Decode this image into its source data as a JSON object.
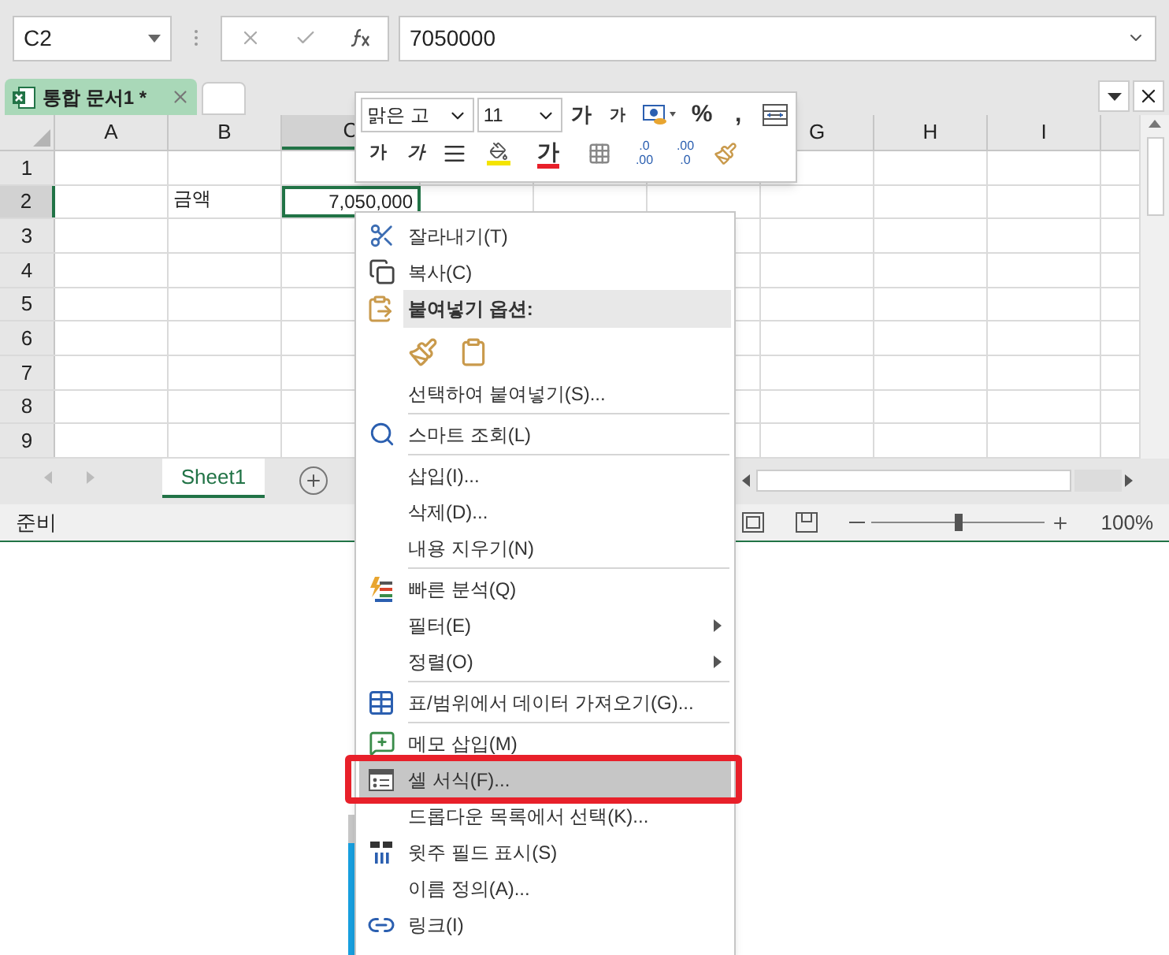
{
  "formula_bar": {
    "name_box": "C2",
    "value": "7050000"
  },
  "workbook_tab": {
    "title": "통합 문서1 *"
  },
  "columns": [
    {
      "kind": "header",
      "label": "A",
      "selected": false
    },
    {
      "kind": "header",
      "label": "B",
      "selected": false
    },
    {
      "kind": "header",
      "label": "C",
      "selected": true
    },
    {
      "kind": "covered"
    },
    {
      "kind": "covered"
    },
    {
      "kind": "covered"
    },
    {
      "kind": "header",
      "label": "G",
      "selected": false
    },
    {
      "kind": "header",
      "label": "H",
      "selected": false
    },
    {
      "kind": "header",
      "label": "I",
      "selected": false
    }
  ],
  "rows": [
    {
      "label": "1",
      "selected": false,
      "cells": {}
    },
    {
      "label": "2",
      "selected": true,
      "cells": {
        "1": "금액",
        "2": "7,050,000"
      }
    },
    {
      "label": "3",
      "selected": false,
      "cells": {}
    },
    {
      "label": "4",
      "selected": false,
      "cells": {}
    },
    {
      "label": "5",
      "selected": false,
      "cells": {}
    },
    {
      "label": "6",
      "selected": false,
      "cells": {}
    },
    {
      "label": "7",
      "selected": false,
      "cells": {}
    },
    {
      "label": "8",
      "selected": false,
      "cells": {}
    },
    {
      "label": "9",
      "selected": false,
      "cells": {}
    }
  ],
  "sheet_tabs": [
    {
      "label": "Sheet1",
      "selected": true
    }
  ],
  "status_bar": {
    "status": "준비",
    "zoom": "100%",
    "level": 0.5
  },
  "mini_toolbar": {
    "font": "맑은 고",
    "size": "11",
    "grow": "가",
    "shrink": "가",
    "percent": "%",
    "comma": ",",
    "bold": "가",
    "italic": "가",
    "font_color": "가",
    "increase_decimal": [
      ".0",
      ".00"
    ],
    "decrease_decimal": [
      ".00",
      ".0"
    ]
  },
  "context_menu": [
    {
      "kind": "item",
      "label": "잘라내기(T)",
      "selected": false
    },
    {
      "kind": "item",
      "label": "복사(C)",
      "selected": false
    },
    {
      "kind": "header",
      "label": "붙여넣기 옵션:"
    },
    {
      "kind": "paste-options"
    },
    {
      "kind": "item",
      "label": "선택하여 붙여넣기(S)...",
      "selected": false
    },
    {
      "kind": "separator"
    },
    {
      "kind": "item",
      "label": "스마트 조회(L)",
      "selected": false
    },
    {
      "kind": "separator"
    },
    {
      "kind": "item",
      "label": "삽입(I)...",
      "selected": false
    },
    {
      "kind": "item",
      "label": "삭제(D)...",
      "selected": false
    },
    {
      "kind": "item",
      "label": "내용 지우기(N)",
      "selected": false
    },
    {
      "kind": "separator"
    },
    {
      "kind": "item",
      "label": "빠른 분석(Q)",
      "selected": false
    },
    {
      "kind": "item",
      "label": "필터(E)",
      "selected": false,
      "submenu": true
    },
    {
      "kind": "item",
      "label": "정렬(O)",
      "selected": false,
      "submenu": true
    },
    {
      "kind": "separator"
    },
    {
      "kind": "item",
      "label": "표/범위에서 데이터 가져오기(G)...",
      "selected": false
    },
    {
      "kind": "separator"
    },
    {
      "kind": "item",
      "label": "메모 삽입(M)",
      "selected": false
    },
    {
      "kind": "item",
      "label": "셀 서식(F)...",
      "selected": true,
      "highlighted": true
    },
    {
      "kind": "item",
      "label": "드롭다운 목록에서 선택(K)...",
      "selected": false
    },
    {
      "kind": "item",
      "label": "윗주 필드 표시(S)",
      "selected": false
    },
    {
      "kind": "item",
      "label": "이름 정의(A)...",
      "selected": false
    },
    {
      "kind": "item",
      "label": "링크(I)",
      "selected": false
    }
  ]
}
